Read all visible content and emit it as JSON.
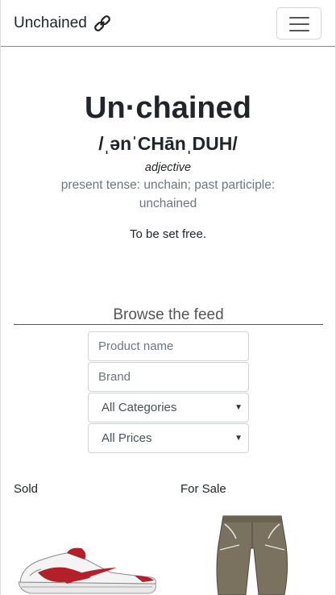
{
  "navbar": {
    "brand": "Unchained",
    "brand_icon": "chain-link-icon",
    "menu_icon": "hamburger-menu-icon"
  },
  "hero": {
    "word": "Un·chained",
    "pronunciation": "/ˌənˈCHānˌDUH/",
    "part_of_speech": "adjective",
    "forms": "present tense: unchain; past participle: unchained",
    "meaning": "To be set free."
  },
  "feed": {
    "heading": "Browse the feed",
    "product_name_placeholder": "Product name",
    "brand_placeholder": "Brand",
    "category_selected": "All Categories",
    "price_selected": "All Prices"
  },
  "listings": {
    "sold_label": "Sold",
    "for_sale_label": "For Sale"
  },
  "colors": {
    "sneaker_red": "#b3202a",
    "pants_olive": "#7a715f"
  }
}
